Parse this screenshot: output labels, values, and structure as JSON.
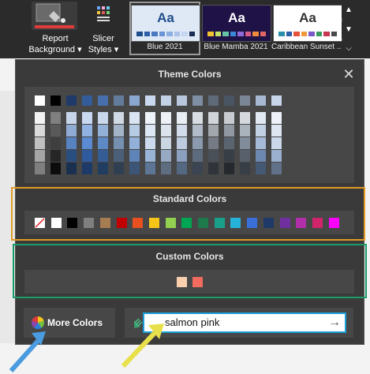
{
  "ribbon": {
    "report_background_line1": "Report",
    "report_background_line2": "Background ▾",
    "slicer_styles_line1": "Slicer",
    "slicer_styles_line2": "Styles ▾",
    "themes": [
      {
        "name": "Blue 2021",
        "aa": "Aa",
        "bg": "#dfe8f5",
        "fg": "#1f4e8c",
        "swatches": [
          "#1f4e8c",
          "#2f5fa8",
          "#4a78c2",
          "#6a94d6",
          "#8db0e3",
          "#a8c2ea",
          "#c5d6f1",
          "#1b2d52"
        ]
      },
      {
        "name": "Blue Mamba 2021",
        "aa": "Aa",
        "bg": "#1e1247",
        "fg": "#ffffff",
        "swatches": [
          "#f1c232",
          "#c6e06a",
          "#66c2a5",
          "#3a88d8",
          "#8e6bd6",
          "#d65a8a",
          "#f08a3c",
          "#e06666"
        ]
      },
      {
        "name": "Caribbean Sunset ...",
        "aa": "Aa",
        "bg": "#ffffff",
        "fg": "#333333",
        "swatches": [
          "#2a8fa8",
          "#2f5fa8",
          "#e5533d",
          "#f19a3c",
          "#7a5ac8",
          "#3c9a5f",
          "#c7364f",
          "#4a4a4a"
        ]
      }
    ],
    "scroll_up": "▲",
    "scroll_down": "▼",
    "expand": "⌵"
  },
  "panel": {
    "theme_colors_title": "Theme Colors",
    "standard_colors_title": "Standard Colors",
    "custom_colors_title": "Custom Colors",
    "more_colors_label": "More Colors",
    "close": "✕",
    "hex_value": "salmon pink",
    "go_arrow": "→"
  },
  "theme_colors": {
    "top_row": [
      "#ffffff",
      "#000000",
      "#1f3a68",
      "#345c99",
      "#476fab",
      "#637c9c",
      "#8aa7cf",
      "#c9d8ee",
      "#c3d1e4",
      "#b8c7db",
      "#7e8fa3",
      "#5e6a78",
      "#4a5563",
      "#7a8595",
      "#a6b8d2",
      "#c8d6ea"
    ],
    "shade_rows": [
      [
        "#f2f2f2",
        "#7f7f7f",
        "#c7d5ea",
        "#c8d8f0",
        "#cad8ec",
        "#d1d9e4",
        "#dbe5f2",
        "#eef3fa",
        "#edf1f6",
        "#e9eef4",
        "#d8dde4",
        "#d1d4d8",
        "#c8ccd1",
        "#d5d9de",
        "#e1e8f2",
        "#eef2f8"
      ],
      [
        "#d9d9d9",
        "#595959",
        "#8fabd4",
        "#90b1e1",
        "#93b0d8",
        "#a3b3c8",
        "#b7cbe5",
        "#dde7f4",
        "#dce3ec",
        "#d3dcea",
        "#b2bcc9",
        "#a2a7ae",
        "#9198a2",
        "#aab2bc",
        "#c3d1e4",
        "#dde5f1"
      ],
      [
        "#bfbfbf",
        "#3f3f3f",
        "#5782c0",
        "#5a8ad2",
        "#5d89c4",
        "#7590b0",
        "#93b1d8",
        "#cddaee",
        "#cbd6e3",
        "#bdcbe0",
        "#8b9aae",
        "#747b85",
        "#5a6470",
        "#808c9a",
        "#a5bad6",
        "#cbd8ea"
      ],
      [
        "#a5a5a5",
        "#262626",
        "#2b4e80",
        "#2f5aa0",
        "#335d94",
        "#4a5f78",
        "#5f84b8",
        "#9ab4d8",
        "#98aac3",
        "#8aa0be",
        "#5d6b7e",
        "#4a5058",
        "#383e46",
        "#57606b",
        "#6d88b0",
        "#9bb0cf"
      ],
      [
        "#7f7f7f",
        "#0c0c0c",
        "#1a3050",
        "#1e3a68",
        "#213d62",
        "#2f3e50",
        "#3d5678",
        "#5d7596",
        "#5e6d80",
        "#546882",
        "#3b4452",
        "#30343a",
        "#25292e",
        "#383e46",
        "#455874",
        "#62718a"
      ]
    ]
  },
  "standard_colors": [
    "none",
    "#ffffff",
    "#000000",
    "#7f7f7f",
    "#a67c52",
    "#c00000",
    "#e8501f",
    "#f5c518",
    "#92d050",
    "#00a651",
    "#1e7a4c",
    "#1aa08a",
    "#26b3d9",
    "#3a6fd8",
    "#1f3a68",
    "#7030a0",
    "#b02fa8",
    "#d1246b",
    "#ff00ff"
  ],
  "custom_colors": [
    "#f9cfae",
    "#f26b5f"
  ]
}
